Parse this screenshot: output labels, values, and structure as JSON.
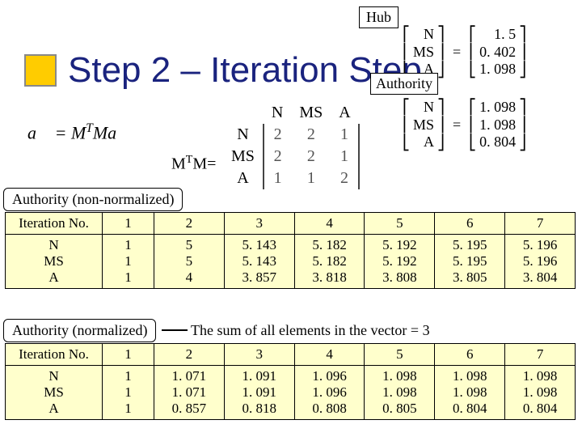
{
  "hub_label": "Hub",
  "authority_label": "Authority",
  "title": "Step 2 – Iteration Step",
  "formula": "a = MᵀMa",
  "mtm_label": "MᵀM=",
  "hub_vec": {
    "labels": [
      "N",
      "MS",
      "A"
    ],
    "values": [
      "1. 5",
      "0. 402",
      "1. 098"
    ]
  },
  "auth_vec": {
    "labels": [
      "N",
      "MS",
      "A"
    ],
    "values": [
      "1. 098",
      "1. 098",
      "0. 804"
    ]
  },
  "matrix": {
    "col_headers": [
      "N",
      "MS",
      "A"
    ],
    "row_headers": [
      "N",
      "MS",
      "A"
    ],
    "rows": [
      [
        "2",
        "2",
        "1"
      ],
      [
        "2",
        "2",
        "1"
      ],
      [
        "1",
        "1",
        "2"
      ]
    ]
  },
  "section_labels": {
    "auth_nn": "Authority (non-normalized)",
    "auth_n": "Authority (normalized)"
  },
  "note": "The sum of all elements in the vector = 3",
  "table1": {
    "headers": [
      "Iteration No.",
      "1",
      "2",
      "3",
      "4",
      "5",
      "6",
      "7"
    ],
    "rowhead": [
      "N",
      "MS",
      "A"
    ],
    "cols": [
      [
        "1",
        "1",
        "1"
      ],
      [
        "5",
        "5",
        "4"
      ],
      [
        "5. 143",
        "5. 143",
        "3. 857"
      ],
      [
        "5. 182",
        "5. 182",
        "3. 818"
      ],
      [
        "5. 192",
        "5. 192",
        "3. 808"
      ],
      [
        "5. 195",
        "5. 195",
        "3. 805"
      ],
      [
        "5. 196",
        "5. 196",
        "3. 804"
      ]
    ]
  },
  "table2": {
    "headers": [
      "Iteration No.",
      "1",
      "2",
      "3",
      "4",
      "5",
      "6",
      "7"
    ],
    "rowhead": [
      "N",
      "MS",
      "A"
    ],
    "cols": [
      [
        "1",
        "1",
        "1"
      ],
      [
        "1. 071",
        "1. 071",
        "0. 857"
      ],
      [
        "1. 091",
        "1. 091",
        "0. 818"
      ],
      [
        "1. 096",
        "1. 096",
        "0. 808"
      ],
      [
        "1. 098",
        "1. 098",
        "0. 805"
      ],
      [
        "1. 098",
        "1. 098",
        "0. 804"
      ],
      [
        "1. 098",
        "1. 098",
        "0. 804"
      ]
    ]
  },
  "chart_data": [
    {
      "type": "table",
      "title": "Authority (non-normalized)",
      "categories": [
        1,
        2,
        3,
        4,
        5,
        6,
        7
      ],
      "series": [
        {
          "name": "N",
          "values": [
            1,
            5,
            5.143,
            5.182,
            5.192,
            5.195,
            5.196
          ]
        },
        {
          "name": "MS",
          "values": [
            1,
            5,
            5.143,
            5.182,
            5.192,
            5.195,
            5.196
          ]
        },
        {
          "name": "A",
          "values": [
            1,
            4,
            3.857,
            3.818,
            3.808,
            3.805,
            3.804
          ]
        }
      ]
    },
    {
      "type": "table",
      "title": "Authority (normalized)",
      "categories": [
        1,
        2,
        3,
        4,
        5,
        6,
        7
      ],
      "series": [
        {
          "name": "N",
          "values": [
            1,
            1.071,
            1.091,
            1.096,
            1.098,
            1.098,
            1.098
          ]
        },
        {
          "name": "MS",
          "values": [
            1,
            1.071,
            1.091,
            1.096,
            1.098,
            1.098,
            1.098
          ]
        },
        {
          "name": "A",
          "values": [
            1,
            0.857,
            0.818,
            0.808,
            0.805,
            0.804,
            0.804
          ]
        }
      ]
    }
  ]
}
